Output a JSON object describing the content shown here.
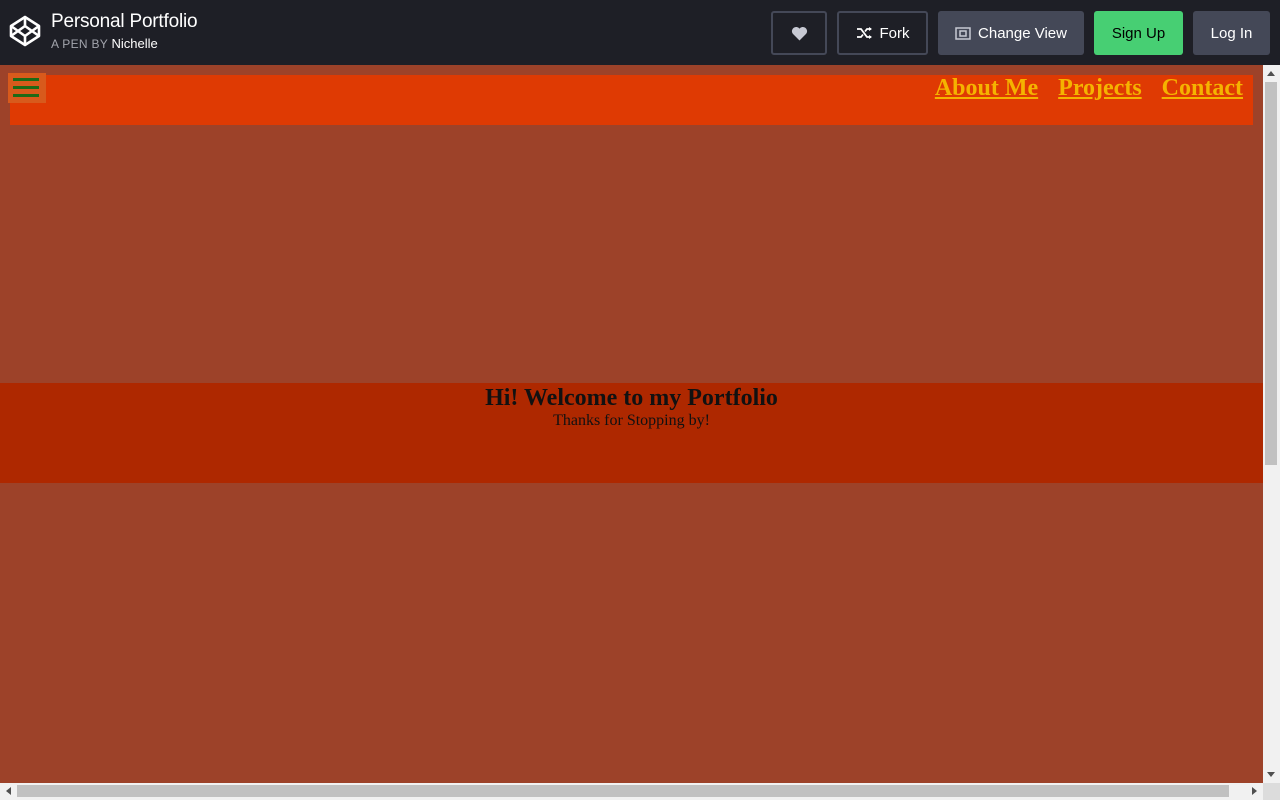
{
  "header": {
    "title": "Personal Portfolio",
    "by_prefix": "A PEN BY",
    "author": "Nichelle",
    "buttons": {
      "fork": "Fork",
      "change_view": "Change View",
      "sign_up": "Sign Up",
      "log_in": "Log In"
    },
    "icons": {
      "logo": "codepen-logo-icon",
      "heart": "heart-icon",
      "fork": "fork-icon",
      "change_view": "change-view-icon"
    },
    "colors": {
      "signup_bg": "#47cf73",
      "button_bg": "#444857",
      "header_bg": "#1e1f26"
    }
  },
  "preview": {
    "menu_icon": "hamburger-icon",
    "nav": {
      "links": [
        "About Me",
        "Projects",
        "Contact"
      ]
    },
    "hero": {
      "title": "Hi! Welcome to my Portfolio",
      "subtitle": "Thanks for Stopping by!"
    },
    "colors": {
      "page_bg": "#9d4229",
      "navbar_bg": "#df3a03",
      "hero_bg": "#ae2800",
      "link_color": "#f5b300",
      "hamburger_lines": "#1d6a16"
    }
  }
}
